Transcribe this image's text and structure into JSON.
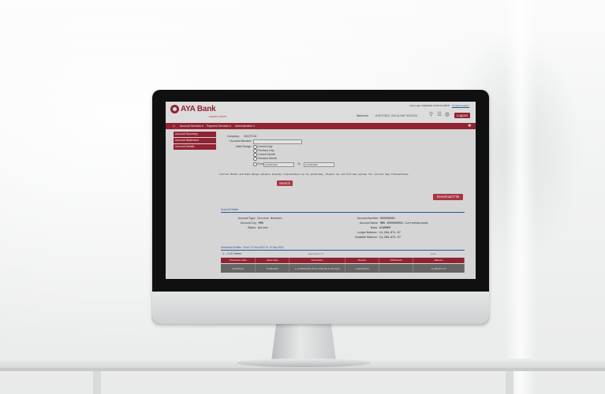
{
  "header": {
    "logo_text": "AYA Bank",
    "logo_sub": "expect more",
    "last_login_label": "Last Login: 2/09/2022 10:30:22 (MMT)",
    "contact_link": "Contact Helpline",
    "welcome_label": "Welcome:",
    "welcome_name": "KSDTOSDI",
    "welcome_id": "000 DLDAF 001DCM",
    "logout_label": "Logout"
  },
  "nav": {
    "home_icon": "⌂",
    "items": [
      "Account Services ▾",
      "Payment Services ▾",
      "Administration ▾"
    ],
    "star_icon": "★"
  },
  "sidebar": {
    "items": [
      "Account Summary",
      "Account Statement",
      "Account Details"
    ]
  },
  "form": {
    "company_label": "Company:",
    "company_value": "0012TC04",
    "account_label": "* Account Number:",
    "date_range_label": "Date Range:",
    "options": [
      "Current Day",
      "Previous Day",
      "Current Month",
      "Previous Month"
    ],
    "from_label": "From",
    "from_value": "2/1/09/2022",
    "to_label": "To",
    "to_value": "2/1/09/2022",
    "note": "Current Month and Date Range options display transactions up to yesterday. Please use Current Day option for current Day transactions.",
    "search_label": "Search",
    "download_label": "Download File"
  },
  "account_details": {
    "title": "Account Details",
    "left": [
      {
        "k": "Account Type:",
        "v": "Current Account"
      },
      {
        "k": "Account Ccy:",
        "v": "MMK"
      },
      {
        "k": "Status:",
        "v": "Active"
      }
    ],
    "right": [
      {
        "k": "Account Number:",
        "v": "000000001"
      },
      {
        "k": "Account Name:",
        "v": "MMK 0000000001 CurrentAccount"
      },
      {
        "k": "Bank:",
        "v": "AYAMMMY"
      },
      {
        "k": "Ledger Balance:",
        "v": "14,284,871.07"
      },
      {
        "k": "Available Balance:",
        "v": "14,283,871.07"
      }
    ]
  },
  "movement": {
    "title": "Movement Details - From: 21 Sep 2022 To: 21 Sep 2022",
    "items_count": "1 – 2 of 2 items",
    "pager": "|◂  ◂  1  ▸  ▸|  1  / 1",
    "pager2": "◂  1  ▸",
    "columns": [
      "Transaction Date",
      "Value Date",
      "Description",
      "Deposit",
      "Withdrawal",
      "Balance"
    ],
    "row": [
      "21/09/2022",
      "21/09/2022",
      "A- ACBRANCE TE 01 SOE 0E 21-09-2022",
      "1,000,000.00",
      "",
      "14,283,871.07"
    ]
  }
}
